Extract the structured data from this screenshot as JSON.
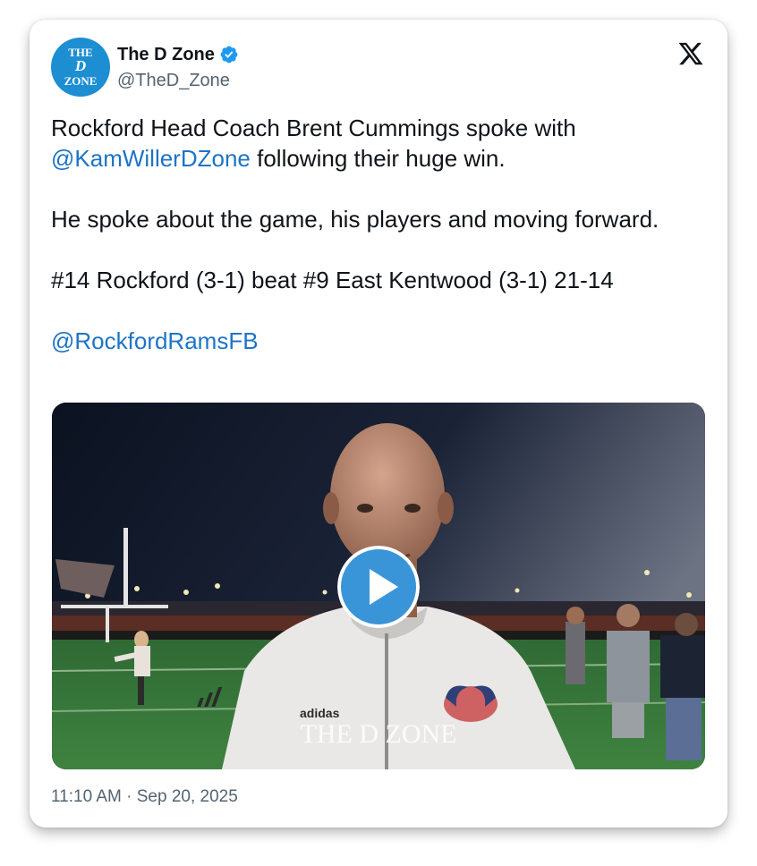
{
  "author": {
    "name": "The D Zone",
    "handle": "@TheD_Zone",
    "avatar_lines": [
      "THE",
      "D",
      "ZONE"
    ],
    "verified_icon": "verified-badge-icon"
  },
  "platform_icon": "x-logo-icon",
  "tweet": {
    "line1_text": "Rockford Head Coach Brent Cummings spoke with ",
    "mention1": "@KamWillerDZone",
    "line2_text": " following their huge win.",
    "para2": "He spoke about the game, his players and moving forward.",
    "para3": "#14 Rockford (3-1) beat #9 East Kentwood (3-1) 21-14",
    "mention2": "@RockfordRamsFB"
  },
  "media": {
    "watermark": "THE D ZONE",
    "jacket_brand": "adidas",
    "play_icon": "play-icon"
  },
  "timestamp": "11:10 AM · Sep 20, 2025",
  "colors": {
    "link": "#1d74c6",
    "avatar_bg": "#1c8ed1",
    "verified": "#1d9bf0",
    "play_button": "#3a95d8"
  }
}
